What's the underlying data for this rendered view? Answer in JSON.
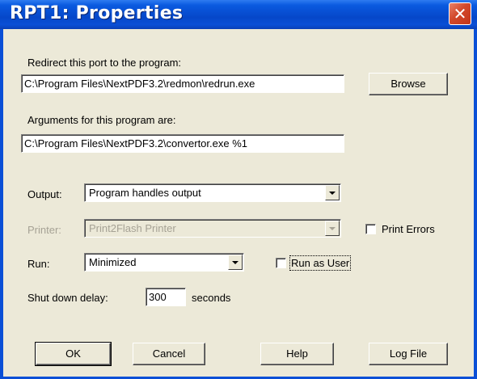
{
  "window": {
    "title": "RPT1: Properties",
    "close_glyph": "✕"
  },
  "redirect": {
    "label": "Redirect this port to the program:",
    "value": "C:\\Program Files\\NextPDF3.2\\redmon\\redrun.exe",
    "browse_label": "Browse"
  },
  "arguments": {
    "label": "Arguments for this program are:",
    "value": "C:\\Program Files\\NextPDF3.2\\convertor.exe %1"
  },
  "output": {
    "label": "Output:",
    "selected": "Program handles output"
  },
  "printer": {
    "label": "Printer:",
    "selected": "Print2Flash Printer",
    "print_errors_label": "Print Errors"
  },
  "run": {
    "label": "Run:",
    "selected": "Minimized",
    "run_as_user_label": "Run as User"
  },
  "shutdown": {
    "label": "Shut down delay:",
    "value": "300",
    "unit": "seconds"
  },
  "buttons": {
    "ok": "OK",
    "cancel": "Cancel",
    "help": "Help",
    "log_file": "Log File"
  },
  "icons": {
    "dropdown": "chevron-down-icon",
    "close": "close-icon"
  }
}
